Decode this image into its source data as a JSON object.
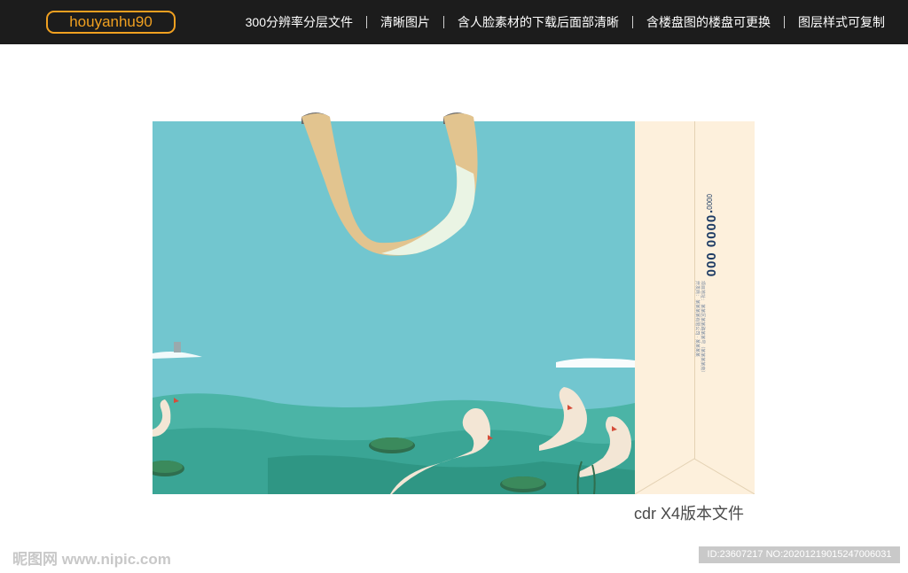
{
  "header": {
    "brand": "houyanhu90",
    "features": [
      {
        "label": "300分辨率分层文件"
      },
      {
        "label": "清晰图片"
      },
      {
        "label": "含人脸素材的下载后面部清晰"
      },
      {
        "label": "含楼盘图的楼盘可更换"
      },
      {
        "label": "图层样式可复制"
      }
    ]
  },
  "bag": {
    "phone_prefix": "0000",
    "phone": "·0000  000",
    "address_line_1": "项目地址：  某某区某某路某某号（某某某某旁）",
    "address_line_2": "开发商：  某某某某有限公司  ·  某某某某"
  },
  "caption": "cdr X4版本文件",
  "footer": {
    "watermark": "昵图网 www.nipic.com",
    "id_text": "ID:23607217 NO:20201219015247006031"
  },
  "colors": {
    "topbar": "#1c1c1c",
    "brand_accent": "#f0a020",
    "bag_blue": "#72c6cf",
    "water": "#4bb4a6",
    "gusset": "#fdf0dc",
    "ribbon": "#e2c48f"
  }
}
